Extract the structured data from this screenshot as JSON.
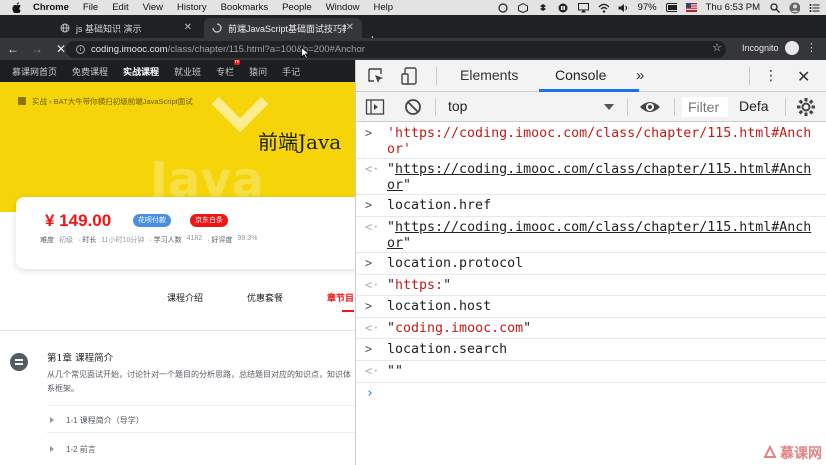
{
  "menubar": {
    "app_name": "Chrome",
    "items": [
      "File",
      "Edit",
      "View",
      "History",
      "Bookmarks",
      "People",
      "Window",
      "Help"
    ],
    "battery": "97%",
    "clock": "Thu 6:53 PM"
  },
  "tabs": [
    {
      "label": "js 基础知识 演示"
    },
    {
      "label": "前端JavaScript基础面试技巧教"
    }
  ],
  "address": {
    "host": "coding.imooc.com",
    "path": "/class/chapter/115.html?a=100&b=200#Anchor",
    "incognito_label": "Incognito"
  },
  "site": {
    "nav": [
      {
        "label": "慕课网首页"
      },
      {
        "label": "免费课程"
      },
      {
        "label": "实战课程"
      },
      {
        "label": "就业班"
      },
      {
        "label": "专栏",
        "badge": "hi"
      },
      {
        "label": "猿问"
      },
      {
        "label": "手记"
      }
    ],
    "breadcrumb": "实战  ›  BAT大牛带你横扫初级前端JavaScript面试",
    "hero_title": "前端Java",
    "price": "¥ 149.00",
    "tag_huabei": "花呗付款",
    "tag_jd": "京东白条",
    "meta": [
      {
        "k": "难度",
        "v": "初级"
      },
      {
        "k": "· 时长",
        "v": "11小时10分钟"
      },
      {
        "k": "· 学习人数",
        "v": "4182"
      },
      {
        "k": "· 好评度",
        "v": "99.3%"
      }
    ],
    "course_tabs": [
      "课程介绍",
      "优惠套餐",
      "章节目"
    ],
    "chapter_title": "第1章 课程简介",
    "chapter_desc": "从几个常见面试开始，讨论针对一个题目的分析思路，总结题目对应的知识点，知识体系框架。",
    "lessons": [
      "1-1 课程简介（导学）",
      "1-2 前言"
    ]
  },
  "devtools": {
    "tabs": [
      "Elements",
      "Console"
    ],
    "context": "top",
    "filter_placeholder": "Filter",
    "levels": "Defa",
    "console": [
      {
        "kind": "in",
        "text": "'https://coding.imooc.com/class/chapter/115.html#Anchor'",
        "style": "str"
      },
      {
        "kind": "out",
        "text": "https://coding.imooc.com/class/chapter/115.html#Anchor",
        "style": "lnk"
      },
      {
        "kind": "in",
        "text": "location.href",
        "style": "plain"
      },
      {
        "kind": "out",
        "text": "https://coding.imooc.com/class/chapter/115.html#Anchor",
        "style": "lnk"
      },
      {
        "kind": "in",
        "text": "location.protocol",
        "style": "plain"
      },
      {
        "kind": "out",
        "text": "https:",
        "style": "str"
      },
      {
        "kind": "in",
        "text": "location.host",
        "style": "plain"
      },
      {
        "kind": "out",
        "text": "coding.imooc.com",
        "style": "str"
      },
      {
        "kind": "in",
        "text": "location.search",
        "style": "plain"
      },
      {
        "kind": "out",
        "text": "",
        "style": "str"
      }
    ]
  },
  "watermark": "慕课网"
}
